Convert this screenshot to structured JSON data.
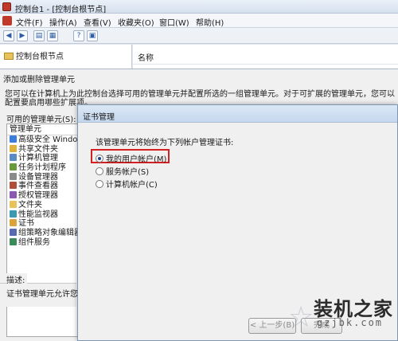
{
  "window": {
    "title": "控制台1 - [控制台根节点]"
  },
  "menu": [
    {
      "label": "文件(F)"
    },
    {
      "label": "操作(A)"
    },
    {
      "label": "查看(V)"
    },
    {
      "label": "收藏夹(O)"
    },
    {
      "label": "窗口(W)"
    },
    {
      "label": "帮助(H)"
    }
  ],
  "toolbar": {
    "buttons": [
      {
        "icon": "back-arrow-icon"
      },
      {
        "icon": "forward-arrow-icon"
      },
      {
        "icon": "show-hide-tree-icon"
      },
      {
        "icon": "panel-icon"
      },
      {
        "icon": "help-icon"
      },
      {
        "icon": "properties-icon"
      }
    ]
  },
  "tree": {
    "root_label": "控制台根节点"
  },
  "list": {
    "column_name": "名称"
  },
  "snapin_dialog": {
    "title": "添加或删除管理单元",
    "description": "您可以在计算机上为此控制台选择可用的管理单元并配置所选的一组管理单元。对于可扩展的管理单元，您可以配置要启用哪些扩展项。",
    "available_label": "可用的管理单元(S):",
    "list_header": "管理单元",
    "snapins": [
      {
        "label": "高级安全 Windows",
        "color": "#3b7dd8"
      },
      {
        "label": "共享文件夹",
        "color": "#e0b23c"
      },
      {
        "label": "计算机管理",
        "color": "#5a8bc4"
      },
      {
        "label": "任务计划程序",
        "color": "#6a9a3b"
      },
      {
        "label": "设备管理器",
        "color": "#8a8a8a"
      },
      {
        "label": "事件查看器",
        "color": "#b0503a"
      },
      {
        "label": "授权管理器",
        "color": "#8a5ab0"
      },
      {
        "label": "文件夹",
        "color": "#e8c25a"
      },
      {
        "label": "性能监视器",
        "color": "#3a9ab0"
      },
      {
        "label": "证书",
        "color": "#d8a43b"
      },
      {
        "label": "组策略对象编辑器",
        "color": "#5a6ab0"
      },
      {
        "label": "组件服务",
        "color": "#3b8a5a"
      }
    ],
    "description_label": "描述:",
    "description_text": "证书管理单元允许您"
  },
  "cert_dialog": {
    "title": "证书管理",
    "prompt": "该管理单元将始终为下列帐户管理证书:",
    "options": [
      {
        "label": "我的用户帐户(M)",
        "checked": true
      },
      {
        "label": "服务帐户(S)",
        "checked": false
      },
      {
        "label": "计算机帐户(C)",
        "checked": false
      }
    ],
    "buttons": {
      "back": "< 上一步(B)",
      "finish": "完成"
    }
  },
  "watermark": {
    "text": "装机之家",
    "url": "gzjbk.com"
  }
}
